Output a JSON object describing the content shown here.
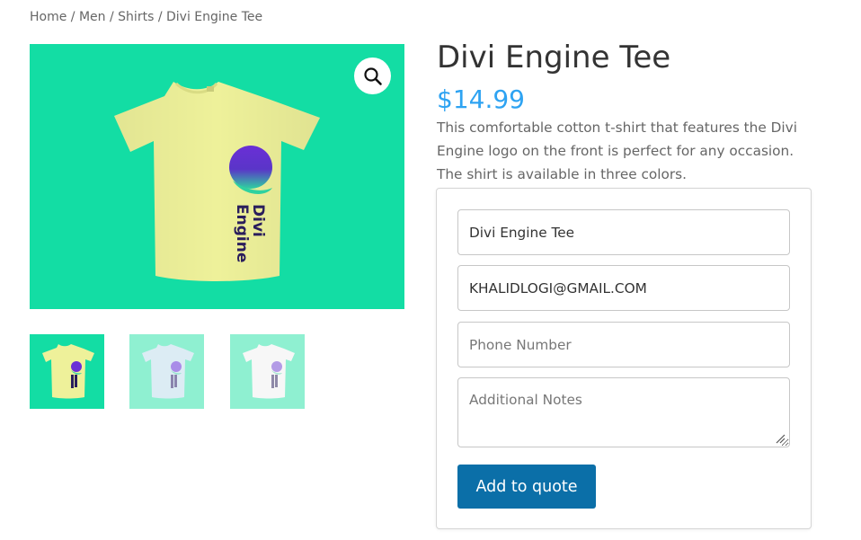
{
  "breadcrumb": {
    "items": [
      "Home",
      "Men",
      "Shirts",
      "Divi Engine Tee"
    ],
    "separator": "/"
  },
  "product": {
    "title": "Divi Engine Tee",
    "price": "$14.99",
    "description": "This comfortable cotton t-shirt that features the Divi Engine logo on the front is perfect for any occasion. The shirt is available in three colors.",
    "logo_text_line1": "Divi",
    "logo_text_line2": "Engine"
  },
  "gallery": {
    "main_bg": "#13dda4",
    "main_shirt_color": "#eef19a",
    "thumbnails": [
      {
        "bg": "#13dda4",
        "shirt": "#eef19a"
      },
      {
        "bg": "#8ff0d1",
        "shirt": "#dcecf4"
      },
      {
        "bg": "#8ff0d1",
        "shirt": "#f7f7f7"
      }
    ],
    "zoom_icon": "magnifier-icon"
  },
  "quote_form": {
    "name_value": "Divi Engine Tee",
    "email_value": "KHALIDLOGI@GMAIL.COM",
    "phone_placeholder": "Phone Number",
    "notes_placeholder": "Additional Notes",
    "submit_label": "Add to quote"
  },
  "colors": {
    "accent": "#2ea3f2",
    "button": "#0b6fa8",
    "logo_purple": "#6a2fd6",
    "logo_teal": "#2fd1a0",
    "logo_text": "#2a1e5c"
  }
}
